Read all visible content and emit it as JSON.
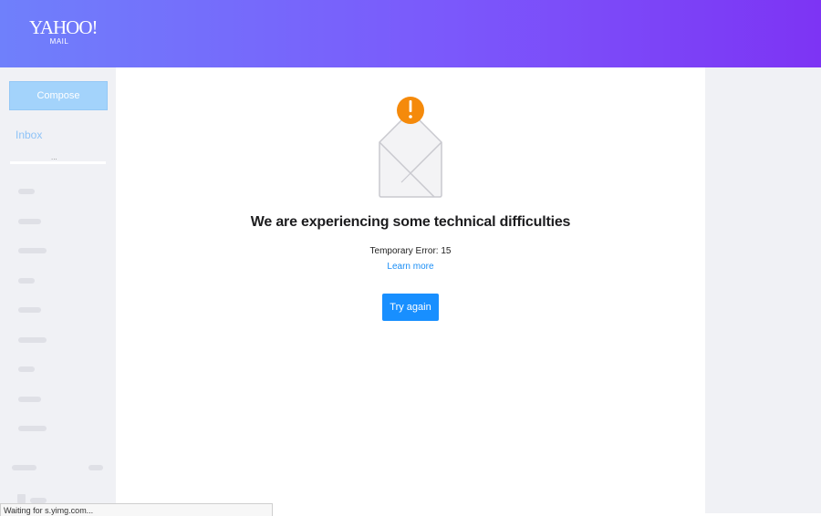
{
  "header": {
    "logo_main": "YAHOO!",
    "logo_sub": "MAIL"
  },
  "sidebar": {
    "compose_label": "Compose",
    "inbox_label": "Inbox",
    "inbox_indicator": "..."
  },
  "main": {
    "heading": "We are experiencing some technical difficulties",
    "error_text": "Temporary Error: 15",
    "learn_more": "Learn more",
    "try_again": "Try again"
  },
  "status_bar": {
    "text": "Waiting for s.yimg.com..."
  },
  "colors": {
    "header_gradient_start": "#6f80fb",
    "header_gradient_end": "#7d34f4",
    "accent_blue": "#188fff",
    "warning_orange": "#f58a0b"
  }
}
